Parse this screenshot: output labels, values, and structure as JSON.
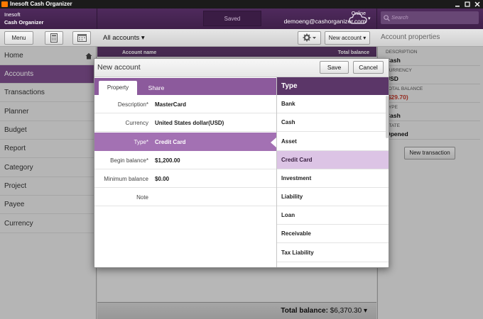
{
  "window": {
    "title": "Inesoft Cash Organizer"
  },
  "header": {
    "brand_line1": "Inesoft",
    "brand_line2": "Cash Organizer",
    "sync_status": "Saved",
    "online_status": "Online",
    "account_email": "demoeng@cashorganizer.com",
    "search_placeholder": "Search"
  },
  "toolbar": {
    "menu_label": "Menu",
    "account_filter": "All accounts ▾",
    "new_account_label": "New account ▾",
    "panel_title": "Account properties"
  },
  "sidebar": {
    "items": [
      {
        "label": "Home"
      },
      {
        "label": "Accounts"
      },
      {
        "label": "Transactions"
      },
      {
        "label": "Planner"
      },
      {
        "label": "Budget"
      },
      {
        "label": "Report"
      },
      {
        "label": "Category"
      },
      {
        "label": "Project"
      },
      {
        "label": "Payee"
      },
      {
        "label": "Currency"
      }
    ],
    "active_index": 1
  },
  "table": {
    "col_name": "Account name",
    "col_balance": "Total balance"
  },
  "footer": {
    "total_label": "Total balance:",
    "total_value": "$6,370.30",
    "chevron": "▾"
  },
  "properties": {
    "description_label": "DESCRIPTION",
    "description_value": "Cash",
    "currency_label": "CURRENCY",
    "currency_value": "USD",
    "balance_label": "TOTAL BALANCE",
    "balance_value": "($29.70)",
    "type_label": "TYPE",
    "type_value": "Cash",
    "state_label": "STATE",
    "state_value": "Opened",
    "new_transaction_label": "New transaction"
  },
  "dialog": {
    "title": "New account",
    "save_label": "Save",
    "cancel_label": "Cancel",
    "tabs": [
      {
        "label": "Property"
      },
      {
        "label": "Share"
      }
    ],
    "fields": [
      {
        "label": "Description*",
        "value": "MasterCard"
      },
      {
        "label": "Currency",
        "value": "United States dollar(USD)"
      },
      {
        "label": "Type*",
        "value": "Credit Card"
      },
      {
        "label": "Begin balance*",
        "value": "$1,200.00"
      },
      {
        "label": "Minimum balance",
        "value": "$0.00"
      },
      {
        "label": "Note",
        "value": ""
      }
    ],
    "type_list_title": "Type",
    "types": [
      {
        "label": "Bank"
      },
      {
        "label": "Cash"
      },
      {
        "label": "Asset"
      },
      {
        "label": "Credit Card"
      },
      {
        "label": "Investment"
      },
      {
        "label": "Liability"
      },
      {
        "label": "Loan"
      },
      {
        "label": "Receivable"
      },
      {
        "label": "Tax Liability"
      }
    ],
    "selected_type_index": 3
  },
  "colors": {
    "brand_purple": "#4f2a5d",
    "selection_purple": "#a371b3",
    "negative_red": "#c0392b"
  }
}
